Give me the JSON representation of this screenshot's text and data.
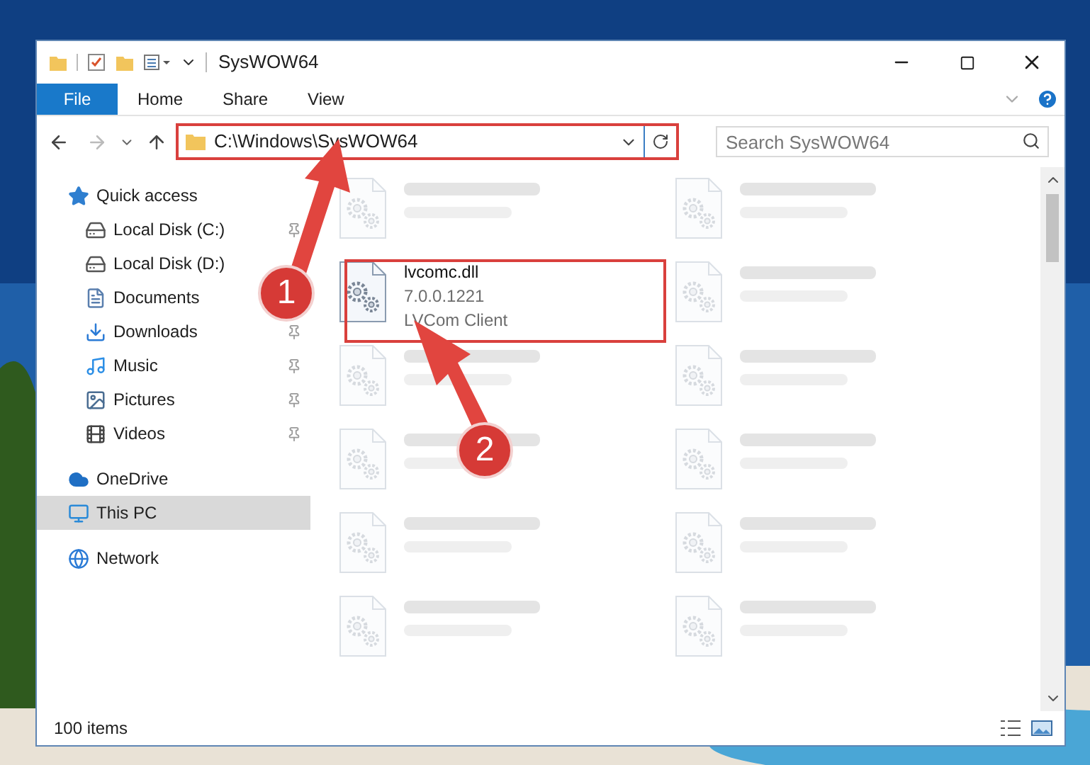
{
  "window": {
    "title": "SysWOW64"
  },
  "ribbon_tabs": [
    {
      "label": "File",
      "kind": "file",
      "selected": false
    },
    {
      "label": "Home",
      "kind": "tab",
      "selected": false
    },
    {
      "label": "Share",
      "kind": "tab",
      "selected": false
    },
    {
      "label": "View",
      "kind": "tab",
      "selected": false
    }
  ],
  "address": {
    "path": "C:\\Windows\\SysWOW64"
  },
  "search": {
    "placeholder": "Search SysWOW64"
  },
  "nav": [
    {
      "label": "Quick access",
      "kind": "star",
      "pinned": false,
      "selected": false,
      "children": [
        {
          "label": "Local Disk (C:)",
          "kind": "drive",
          "pinned": true,
          "selected": false
        },
        {
          "label": "Local Disk (D:)",
          "kind": "drive",
          "pinned": false,
          "selected": false
        },
        {
          "label": "Documents",
          "kind": "document",
          "pinned": false,
          "selected": false
        },
        {
          "label": "Downloads",
          "kind": "download",
          "pinned": true,
          "selected": false
        },
        {
          "label": "Music",
          "kind": "music",
          "pinned": true,
          "selected": false
        },
        {
          "label": "Pictures",
          "kind": "pictures",
          "pinned": true,
          "selected": false
        },
        {
          "label": "Videos",
          "kind": "videos",
          "pinned": true,
          "selected": false
        }
      ]
    },
    {
      "label": "OneDrive",
      "kind": "cloud",
      "pinned": false,
      "selected": false
    },
    {
      "label": "This PC",
      "kind": "pc",
      "pinned": false,
      "selected": true
    },
    {
      "label": "Network",
      "kind": "network",
      "pinned": false,
      "selected": false
    }
  ],
  "files": [
    {
      "faded": true
    },
    {
      "faded": true
    },
    {
      "name": "lvcomc.dll",
      "lines": [
        "7.0.0.1221",
        "LVCom Client"
      ],
      "faded": false
    },
    {
      "faded": true
    },
    {
      "faded": true
    },
    {
      "faded": true
    },
    {
      "faded": true
    },
    {
      "faded": true
    },
    {
      "faded": true
    },
    {
      "faded": true
    },
    {
      "faded": true
    },
    {
      "faded": true
    }
  ],
  "status_bar": {
    "count": "100 items"
  },
  "annotations": [
    {
      "label": "1"
    },
    {
      "label": "2"
    }
  ]
}
